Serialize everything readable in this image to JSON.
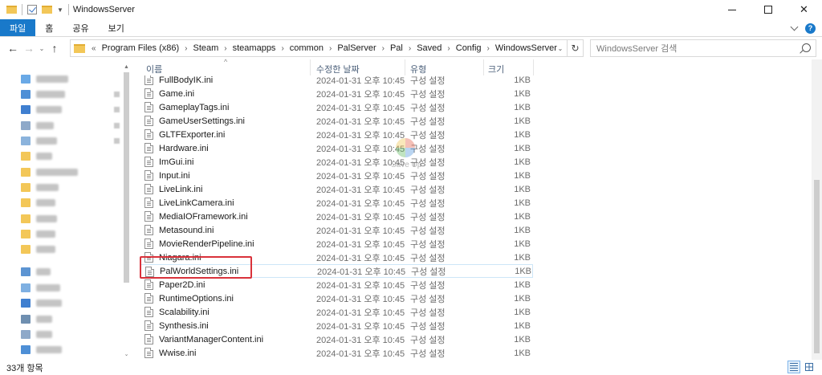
{
  "window": {
    "title": "WindowsServer",
    "controls": {
      "minimize": "",
      "maximize": "",
      "close": "✕"
    }
  },
  "ribbon": {
    "tabs": [
      {
        "label": "파일",
        "active": true
      },
      {
        "label": "홈"
      },
      {
        "label": "공유"
      },
      {
        "label": "보기"
      }
    ]
  },
  "address": {
    "prefix": "«",
    "crumbs": [
      "Program Files (x86)",
      "Steam",
      "steamapps",
      "common",
      "PalServer",
      "Pal",
      "Saved",
      "Config",
      "WindowsServer"
    ],
    "refresh_glyph": "↻"
  },
  "search": {
    "placeholder": "WindowsServer 검색"
  },
  "columns": {
    "name": "이름",
    "date": "수정한 날짜",
    "type": "유형",
    "size": "크기"
  },
  "files": [
    {
      "name": "FullBodyIK.ini",
      "date": "2024-01-31 오후 10:45",
      "type": "구성 설정",
      "size": "1KB"
    },
    {
      "name": "Game.ini",
      "date": "2024-01-31 오후 10:45",
      "type": "구성 설정",
      "size": "1KB"
    },
    {
      "name": "GameplayTags.ini",
      "date": "2024-01-31 오후 10:45",
      "type": "구성 설정",
      "size": "1KB"
    },
    {
      "name": "GameUserSettings.ini",
      "date": "2024-01-31 오후 10:45",
      "type": "구성 설정",
      "size": "1KB"
    },
    {
      "name": "GLTFExporter.ini",
      "date": "2024-01-31 오후 10:45",
      "type": "구성 설정",
      "size": "1KB"
    },
    {
      "name": "Hardware.ini",
      "date": "2024-01-31 오후 10:45",
      "type": "구성 설정",
      "size": "1KB"
    },
    {
      "name": "ImGui.ini",
      "date": "2024-01-31 오후 10:45",
      "type": "구성 설정",
      "size": "1KB"
    },
    {
      "name": "Input.ini",
      "date": "2024-01-31 오후 10:45",
      "type": "구성 설정",
      "size": "1KB"
    },
    {
      "name": "LiveLink.ini",
      "date": "2024-01-31 오후 10:45",
      "type": "구성 설정",
      "size": "1KB"
    },
    {
      "name": "LiveLinkCamera.ini",
      "date": "2024-01-31 오후 10:45",
      "type": "구성 설정",
      "size": "1KB"
    },
    {
      "name": "MediaIOFramework.ini",
      "date": "2024-01-31 오후 10:45",
      "type": "구성 설정",
      "size": "1KB"
    },
    {
      "name": "Metasound.ini",
      "date": "2024-01-31 오후 10:45",
      "type": "구성 설정",
      "size": "1KB"
    },
    {
      "name": "MovieRenderPipeline.ini",
      "date": "2024-01-31 오후 10:45",
      "type": "구성 설정",
      "size": "1KB"
    },
    {
      "name": "Niagara.ini",
      "date": "2024-01-31 오후 10:45",
      "type": "구성 설정",
      "size": "1KB"
    },
    {
      "name": "PalWorldSettings.ini",
      "date": "2024-01-31 오후 10:45",
      "type": "구성 설정",
      "size": "1KB",
      "highlighted": true
    },
    {
      "name": "Paper2D.ini",
      "date": "2024-01-31 오후 10:45",
      "type": "구성 설정",
      "size": "1KB"
    },
    {
      "name": "RuntimeOptions.ini",
      "date": "2024-01-31 오후 10:45",
      "type": "구성 설정",
      "size": "1KB"
    },
    {
      "name": "Scalability.ini",
      "date": "2024-01-31 오후 10:45",
      "type": "구성 설정",
      "size": "1KB"
    },
    {
      "name": "Synthesis.ini",
      "date": "2024-01-31 오후 10:45",
      "type": "구성 설정",
      "size": "1KB"
    },
    {
      "name": "VariantManagerContent.ini",
      "date": "2024-01-31 오후 10:45",
      "type": "구성 설정",
      "size": "1KB"
    },
    {
      "name": "Wwise.ini",
      "date": "2024-01-31 오후 10:45",
      "type": "구성 설정",
      "size": "1KB"
    }
  ],
  "watermark": {
    "text": "Save Up"
  },
  "status": {
    "item_count": "33개 항목"
  },
  "colors": {
    "accent": "#1979ca",
    "highlight_box": "#d9323b",
    "folder": "#f3c758"
  }
}
